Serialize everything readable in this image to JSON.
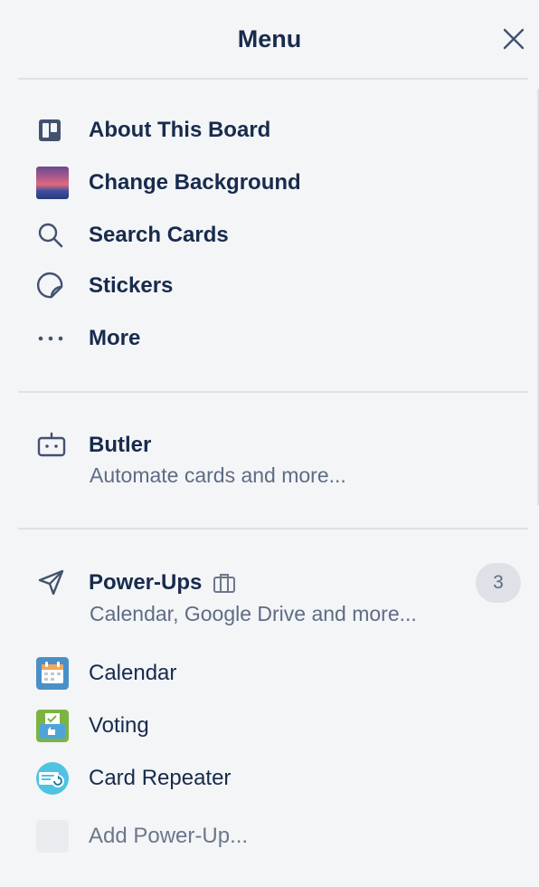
{
  "header": {
    "title": "Menu"
  },
  "main_items": [
    {
      "label": "About This Board",
      "icon": "board-icon"
    },
    {
      "label": "Change Background",
      "icon": "background-thumbnail"
    },
    {
      "label": "Search Cards",
      "icon": "search-icon"
    },
    {
      "label": "Stickers",
      "icon": "sticker-icon"
    },
    {
      "label": "More",
      "icon": "more-icon"
    }
  ],
  "butler": {
    "title": "Butler",
    "subtitle": "Automate cards and more..."
  },
  "powerups": {
    "title": "Power-Ups",
    "subtitle": "Calendar, Google Drive and more...",
    "count": "3",
    "items": [
      {
        "label": "Calendar",
        "icon": "calendar-powerup-icon"
      },
      {
        "label": "Voting",
        "icon": "voting-powerup-icon"
      },
      {
        "label": "Card Repeater",
        "icon": "card-repeater-powerup-icon"
      }
    ],
    "add_label": "Add Power-Up..."
  },
  "colors": {
    "background": "#f4f5f7",
    "text": "#172b4d",
    "muted_text": "#5e6c84",
    "divider": "#dfe1e6"
  }
}
